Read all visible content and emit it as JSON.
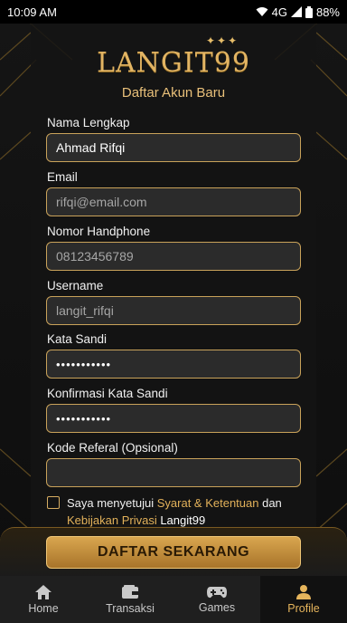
{
  "status": {
    "time": "10:09 AM",
    "network": "4G",
    "battery": "88%"
  },
  "brand": {
    "name": "LANGIT99",
    "sparkles": "✦✦✦"
  },
  "page": {
    "title": "Daftar Akun Baru"
  },
  "form": {
    "full_name": {
      "label": "Nama Lengkap",
      "value": "Ahmad Rifqi"
    },
    "email": {
      "label": "Email",
      "placeholder": "rifqi@email.com"
    },
    "phone": {
      "label": "Nomor Handphone",
      "placeholder": "08123456789"
    },
    "username": {
      "label": "Username",
      "placeholder": "langit_rifqi"
    },
    "password": {
      "label": "Kata Sandi",
      "value": "•••••••••••"
    },
    "confirm_password": {
      "label": "Konfirmasi Kata Sandi",
      "value": "•••••••••••"
    },
    "referral": {
      "label": "Kode Referal (Opsional)",
      "value": ""
    },
    "agreement": {
      "prefix": "Saya menyetujui ",
      "terms_link": "Syarat & Ketentuan",
      "middle": " dan ",
      "privacy_link": "Kebijakan Privasi",
      "suffix": " Langit99",
      "checked": false
    },
    "submit_label": "DAFTAR SEKARANG"
  },
  "tabs": [
    {
      "label": "Home",
      "icon": "home-icon",
      "active": false
    },
    {
      "label": "Transaksi",
      "icon": "wallet-icon",
      "active": false
    },
    {
      "label": "Games",
      "icon": "gamepad-icon",
      "active": false
    },
    {
      "label": "Profile",
      "icon": "profile-icon",
      "active": true
    }
  ],
  "colors": {
    "gold": "#e2b15a",
    "field_bg": "#2b2b2b",
    "background": "#0c0c0c"
  }
}
